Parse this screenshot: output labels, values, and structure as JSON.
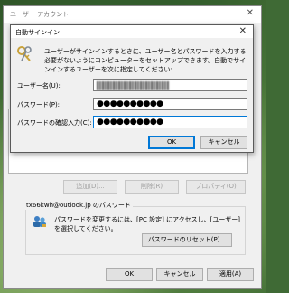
{
  "outer_window": {
    "title": "ユーザー アカウント",
    "close_glyph": "✕",
    "buttons": {
      "add": "追加(D)...",
      "remove": "削除(R)",
      "properties": "プロパティ(O)"
    },
    "password_group": {
      "label": "tx66kwh@outlook.jp のパスワード",
      "text": "パスワードを変更するには、[PC 設定] にアクセスし、[ユーザー] を選択してください。",
      "reset_button": "パスワードのリセット(P)..."
    },
    "footer": {
      "ok": "OK",
      "cancel": "キャンセル",
      "apply": "適用(A)"
    }
  },
  "dialog": {
    "title": "自動サインイン",
    "close_glyph": "✕",
    "description": "ユーザーがサインインするときに、ユーザー名とパスワードを入力する必要がないようにコンピューターをセットアップできます。自動でサインインするユーザーを次に指定してください:",
    "fields": {
      "username_label": "ユーザー名(U):",
      "password_label": "パスワード(P):",
      "password_value": "●●●●●●●●●●",
      "confirm_label": "パスワードの確認入力(C):",
      "confirm_value": "●●●●●●●●●●"
    },
    "ok": "OK",
    "cancel": "キャンセル"
  }
}
